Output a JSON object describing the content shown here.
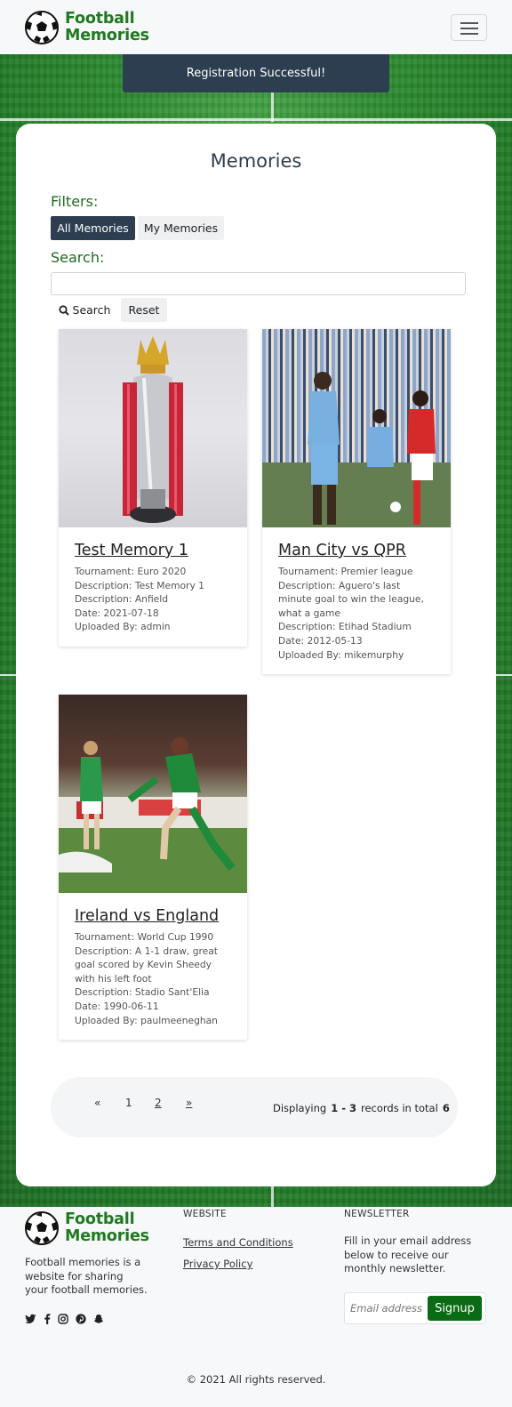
{
  "brand": {
    "line1": "Football",
    "line2": "Memories"
  },
  "header": {
    "menu_icon": "hamburger-icon"
  },
  "alert": {
    "text": "Registration Successful!"
  },
  "memories_page": {
    "title": "Memories",
    "filters_label": "Filters:",
    "filter_all": "All Memories",
    "filter_mine": "My Memories",
    "search_label": "Search:",
    "search_value": "",
    "search_button": "Search",
    "reset_button": "Reset"
  },
  "cards": [
    {
      "title": "Test Memory 1",
      "lines": [
        "Tournament: Euro 2020",
        "Description: Test Memory 1",
        "Description: Anfield",
        "Date: 2021-07-18",
        "Uploaded By: admin"
      ]
    },
    {
      "title": "Man City vs QPR",
      "lines": [
        "Tournament: Premier league",
        "Description: Aguero's last minute goal to win the league, what a game",
        "Description: Etihad Stadium",
        "Date: 2012-05-13",
        "Uploaded By: mikemurphy"
      ]
    },
    {
      "title": "Ireland vs England",
      "lines": [
        "Tournament: World Cup 1990",
        "Description: A 1-1 draw, great goal scored by Kevin Sheedy with his left foot",
        "Description: Stadio Sant'Elia",
        "Date: 1990-06-11",
        "Uploaded By: paulmeeneghan"
      ]
    }
  ],
  "pagination": {
    "prev": "«",
    "pages": [
      "1",
      "2"
    ],
    "next": "»",
    "displaying": "Displaying",
    "range": "1 - 3",
    "records_in_total": "records in total",
    "total": "6"
  },
  "footer": {
    "description": "Football memories is a website for sharing your football memories.",
    "website_heading": "WEBSITE",
    "terms": "Terms and Conditions",
    "privacy": "Privacy Policy",
    "newsletter_heading": "NEWSLETTER",
    "newsletter_text": "Fill in your email address below to receive our monthly newsletter.",
    "email_placeholder": "Email address",
    "signup": "Signup",
    "copyright": "© 2021 All rights reserved.",
    "social_icons": [
      "twitter-icon",
      "facebook-icon",
      "instagram-icon",
      "pinterest-icon",
      "snapchat-icon"
    ]
  },
  "colors": {
    "dark": "#2c3e50",
    "green": "#1f7a1f",
    "signup": "#0b6b14"
  }
}
